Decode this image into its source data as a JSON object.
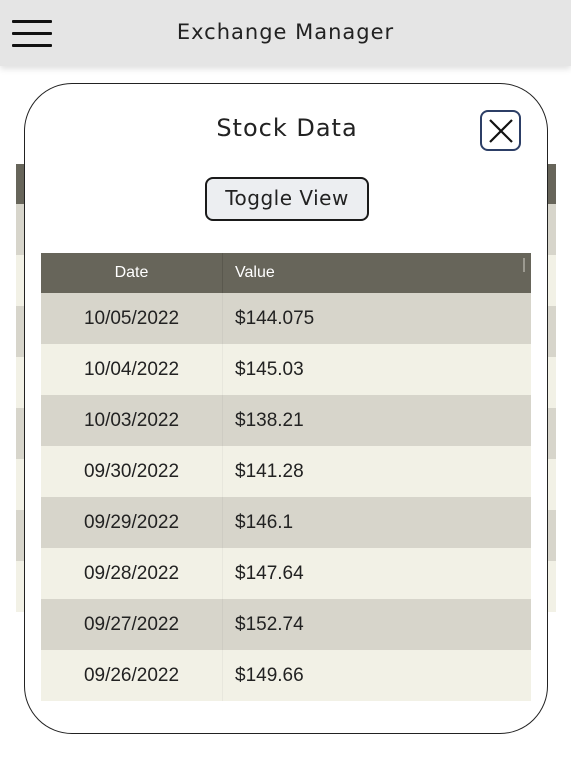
{
  "app": {
    "title": "Exchange Manager"
  },
  "icons": {
    "menu": "hamburger-menu-icon",
    "close": "close-x-icon"
  },
  "colors": {
    "header_bg": "#67655a",
    "row_odd": "#d7d5cb",
    "row_even": "#f2f1e6",
    "close_border": "#2c3e66"
  },
  "modal": {
    "title": "Stock Data",
    "toggle_label": "Toggle View",
    "table": {
      "columns": [
        "Date",
        "Value"
      ],
      "rows": [
        {
          "date": "10/05/2022",
          "value": "$144.075"
        },
        {
          "date": "10/04/2022",
          "value": "$145.03"
        },
        {
          "date": "10/03/2022",
          "value": "$138.21"
        },
        {
          "date": "09/30/2022",
          "value": "$141.28"
        },
        {
          "date": "09/29/2022",
          "value": "$146.1"
        },
        {
          "date": "09/28/2022",
          "value": "$147.64"
        },
        {
          "date": "09/27/2022",
          "value": "$152.74"
        },
        {
          "date": "09/26/2022",
          "value": "$149.66"
        }
      ]
    }
  }
}
